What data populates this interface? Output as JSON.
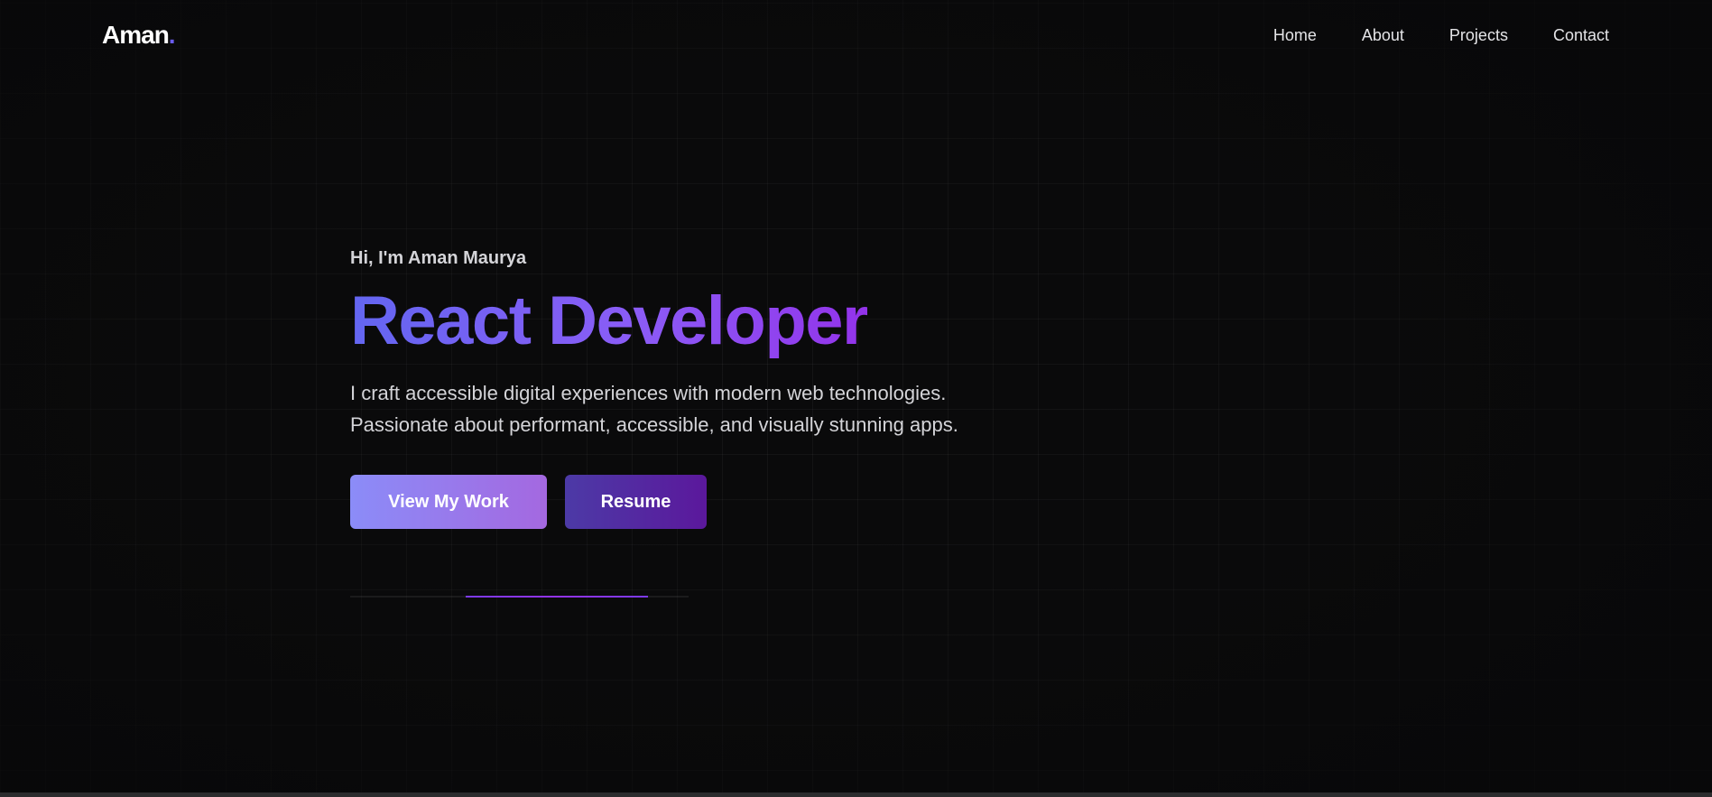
{
  "header": {
    "logo_text": "Aman",
    "logo_dot": ".",
    "nav": [
      {
        "label": "Home"
      },
      {
        "label": "About"
      },
      {
        "label": "Projects"
      },
      {
        "label": "Contact"
      }
    ]
  },
  "hero": {
    "greeting": "Hi, I'm Aman Maurya",
    "title": "React Developer",
    "description_line1": "I craft accessible digital experiences with modern web technologies.",
    "description_line2": "Passionate about performant, accessible, and visually stunning apps.",
    "primary_button": "View My Work",
    "secondary_button": "Resume",
    "progress": {
      "start": 0.34,
      "end": 0.88
    }
  },
  "colors": {
    "background": "#0a0a0b",
    "accent": "#6a5cf0",
    "gradient_start": "#6366f1",
    "gradient_end": "#9333ea",
    "text": "#d4d4d8"
  }
}
